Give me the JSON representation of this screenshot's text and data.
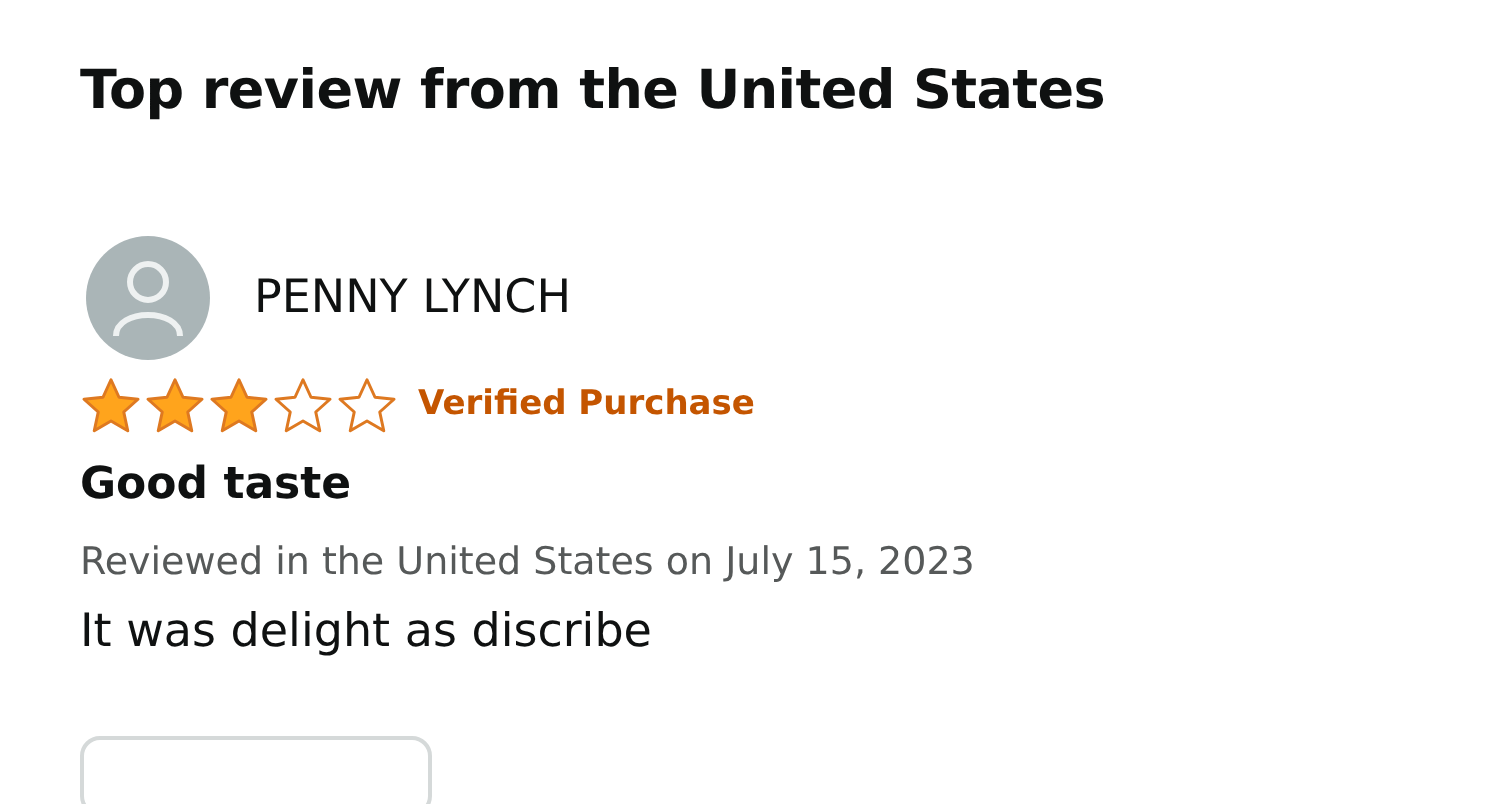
{
  "heading": "Top review from the United States",
  "review": {
    "reviewer": "PENNY LYNCH",
    "stars": 3,
    "badge": "Verified Purchase",
    "title": "Good taste",
    "meta": "Reviewed in the United States on July 15, 2023",
    "body": "It was delight as discribe"
  }
}
